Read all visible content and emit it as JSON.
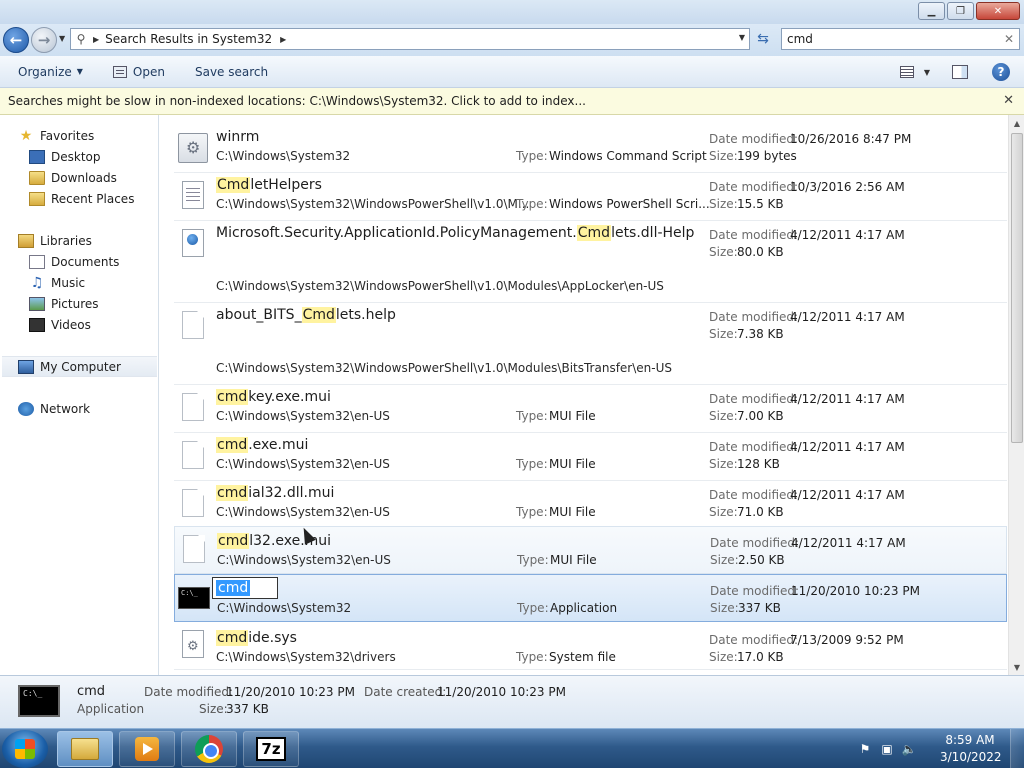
{
  "window": {
    "minimize": "▁",
    "maximize": "❐",
    "close": "✕"
  },
  "address": {
    "back_icon": "←",
    "forward_icon": "→",
    "search_icon": "⚲",
    "separator": "▶",
    "path_text": "Search Results in System32",
    "path_chevron": "▶",
    "dropdown": "▼",
    "refresh_icon": "⇆"
  },
  "search": {
    "value": "cmd",
    "clear_icon": "✕"
  },
  "toolbar": {
    "organize_label": "Organize",
    "organize_caret": "▼",
    "open_label": "Open",
    "save_search_label": "Save search",
    "views_caret": "▼",
    "help_icon": "?"
  },
  "infobar": {
    "message": "Searches might be slow in non-indexed locations: C:\\Windows\\System32. Click to add to index...",
    "close_icon": "✕"
  },
  "nav": {
    "items": [
      {
        "label": "Favorites",
        "icon": "star-icon"
      },
      {
        "label": "Desktop",
        "icon": "desktop-icon"
      },
      {
        "label": "Downloads",
        "icon": "folder-icon"
      },
      {
        "label": "Recent Places",
        "icon": "recent-places-icon"
      },
      {
        "label": "Libraries",
        "icon": "libraries-icon"
      },
      {
        "label": "Documents",
        "icon": "documents-icon"
      },
      {
        "label": "Music",
        "icon": "music-icon"
      },
      {
        "label": "Pictures",
        "icon": "pictures-icon"
      },
      {
        "label": "Videos",
        "icon": "videos-icon"
      },
      {
        "label": "My Computer",
        "icon": "computer-icon"
      },
      {
        "label": "Network",
        "icon": "network-icon"
      }
    ],
    "star_glyph": "★",
    "music_glyph": "♫"
  },
  "labels": {
    "type": "Type:",
    "date_modified": "Date modified:",
    "size": "Size:"
  },
  "results": [
    {
      "name_pre": "winrm",
      "name_hl": "",
      "name_post": "",
      "path": "C:\\Windows\\System32",
      "type": "Windows Command Script",
      "date": "10/26/2016 8:47 PM",
      "size": "199 bytes"
    },
    {
      "name_pre": "",
      "name_hl": "Cmd",
      "name_post": "letHelpers",
      "path": "C:\\Windows\\System32\\WindowsPowerShell\\v1.0\\M...",
      "type": "Windows PowerShell Scri...",
      "date": "10/3/2016 2:56 AM",
      "size": "15.5 KB"
    },
    {
      "name_pre": "Microsoft.Security.ApplicationId.PolicyManagement.",
      "name_hl": "Cmd",
      "name_post": "lets.dll-Help",
      "path": "C:\\Windows\\System32\\WindowsPowerShell\\v1.0\\Modules\\AppLocker\\en-US",
      "type": "",
      "date": "4/12/2011 4:17 AM",
      "size": "80.0 KB"
    },
    {
      "name_pre": "about_BITS_",
      "name_hl": "Cmd",
      "name_post": "lets.help",
      "path": "C:\\Windows\\System32\\WindowsPowerShell\\v1.0\\Modules\\BitsTransfer\\en-US",
      "type": "",
      "date": "4/12/2011 4:17 AM",
      "size": "7.38 KB"
    },
    {
      "name_pre": "",
      "name_hl": "cmd",
      "name_post": "key.exe.mui",
      "path": "C:\\Windows\\System32\\en-US",
      "type": "MUI File",
      "date": "4/12/2011 4:17 AM",
      "size": "7.00 KB"
    },
    {
      "name_pre": "",
      "name_hl": "cmd",
      "name_post": ".exe.mui",
      "path": "C:\\Windows\\System32\\en-US",
      "type": "MUI File",
      "date": "4/12/2011 4:17 AM",
      "size": "128 KB"
    },
    {
      "name_pre": "",
      "name_hl": "cmd",
      "name_post": "ial32.dll.mui",
      "path": "C:\\Windows\\System32\\en-US",
      "type": "MUI File",
      "date": "4/12/2011 4:17 AM",
      "size": "71.0 KB"
    },
    {
      "name_pre": "",
      "name_hl": "cmd",
      "name_post": "l32.exe.mui",
      "path": "C:\\Windows\\System32\\en-US",
      "type": "MUI File",
      "date": "4/12/2011 4:17 AM",
      "size": "2.50 KB"
    },
    {
      "name_edit": "cmd",
      "path": "C:\\Windows\\System32",
      "type": "Application",
      "date": "11/20/2010 10:23 PM",
      "size": "337 KB"
    },
    {
      "name_pre": "",
      "name_hl": "cmd",
      "name_post": "ide.sys",
      "path": "C:\\Windows\\System32\\drivers",
      "type": "System file",
      "date": "7/13/2009 9:52 PM",
      "size": "17.0 KB"
    }
  ],
  "scrollbar": {
    "up": "▲",
    "down": "▼"
  },
  "details": {
    "name": "cmd",
    "kind": "Application",
    "date_modified_label": "Date modified:",
    "date_modified": "11/20/2010 10:23 PM",
    "date_created_label": "Date created:",
    "date_created": "11/20/2010 10:23 PM",
    "size_label": "Size:",
    "size": "337 KB"
  },
  "taskbar": {
    "sevenzip_label": "7z",
    "time": "8:59 AM",
    "date": "3/10/2022",
    "tray_flag": "⚑",
    "tray_network": "▣",
    "tray_volume": "🔈"
  }
}
